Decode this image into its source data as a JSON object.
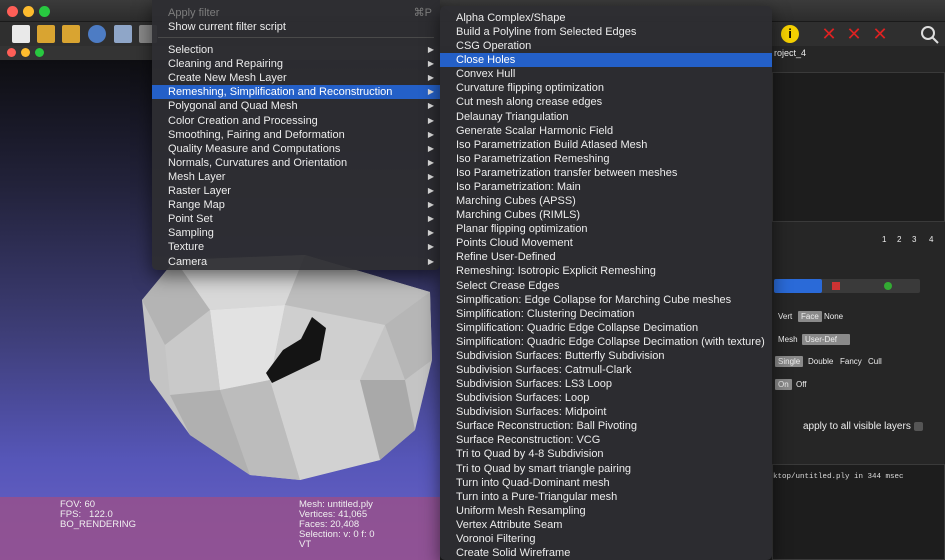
{
  "toolbar": {
    "tab_name": "roject_4"
  },
  "viewer_info": {
    "left_lines": [
      "FOV: 60",
      "FPS:   122.0",
      "BO_RENDERING"
    ],
    "right_lines": [
      "Mesh: untitled.ply",
      "Vertices: 41,065",
      "Faces: 20,408",
      "Selection: v: 0 f: 0",
      "VT"
    ]
  },
  "right_panel": {
    "page_numbers": [
      "1",
      "2",
      "3",
      "4"
    ],
    "vert_label": "Vert",
    "face_btn": "Face",
    "none_btn": "None",
    "mesh_label": "Mesh",
    "userdef_btn": "User-Def",
    "single_btn": "Single",
    "double_btn": "Double",
    "fancy_btn": "Fancy",
    "cull_btn": "Cull",
    "on_btn": "On",
    "off_btn": "Off",
    "apply_all_label": "apply to all visible layers",
    "log_line": "ktop/untitled.ply in 344 msec"
  },
  "filters_menu": {
    "apply_filter": "Apply filter",
    "apply_shortcut": "⌘P",
    "show_script": "Show current filter script",
    "items": [
      "Selection",
      "Cleaning and Repairing",
      "Create New Mesh Layer",
      "Remeshing, Simplification and Reconstruction",
      "Polygonal and Quad Mesh",
      "Color Creation and Processing",
      "Smoothing, Fairing and Deformation",
      "Quality Measure and Computations",
      "Normals, Curvatures and Orientation",
      "Mesh Layer",
      "Raster Layer",
      "Range Map",
      "Point Set",
      "Sampling",
      "Texture",
      "Camera"
    ]
  },
  "remesh_menu": {
    "items": [
      "Alpha Complex/Shape",
      "Build a Polyline from Selected Edges",
      "CSG Operation",
      "Close Holes",
      "Convex Hull",
      "Curvature flipping optimization",
      "Cut mesh along crease edges",
      "Delaunay Triangulation",
      "Generate Scalar Harmonic Field",
      "Iso Parametrization Build Atlased Mesh",
      "Iso Parametrization Remeshing",
      "Iso Parametrization transfer between meshes",
      "Iso Parametrization: Main",
      "Marching Cubes (APSS)",
      "Marching Cubes (RIMLS)",
      "Planar flipping optimization",
      "Points Cloud Movement",
      "Refine User-Defined",
      "Remeshing: Isotropic Explicit Remeshing",
      "Select Crease Edges",
      "Simplfication: Edge Collapse for Marching Cube meshes",
      "Simplification: Clustering Decimation",
      "Simplification: Quadric Edge Collapse Decimation",
      "Simplification: Quadric Edge Collapse Decimation (with texture)",
      "Subdivision Surfaces: Butterfly Subdivision",
      "Subdivision Surfaces: Catmull-Clark",
      "Subdivision Surfaces: LS3 Loop",
      "Subdivision Surfaces: Loop",
      "Subdivision Surfaces: Midpoint",
      "Surface Reconstruction: Ball Pivoting",
      "Surface Reconstruction: VCG",
      "Tri to Quad by 4-8 Subdivision",
      "Tri to Quad by smart triangle pairing",
      "Turn into Quad-Dominant mesh",
      "Turn into a Pure-Triangular mesh",
      "Uniform Mesh Resampling",
      "Vertex Attribute Seam",
      "Voronoi Filtering",
      "Create Solid Wireframe"
    ]
  },
  "colors": {
    "highlight": "#2460c8",
    "menu_bg": "#2e2e32",
    "info_bar": "#96508c"
  }
}
